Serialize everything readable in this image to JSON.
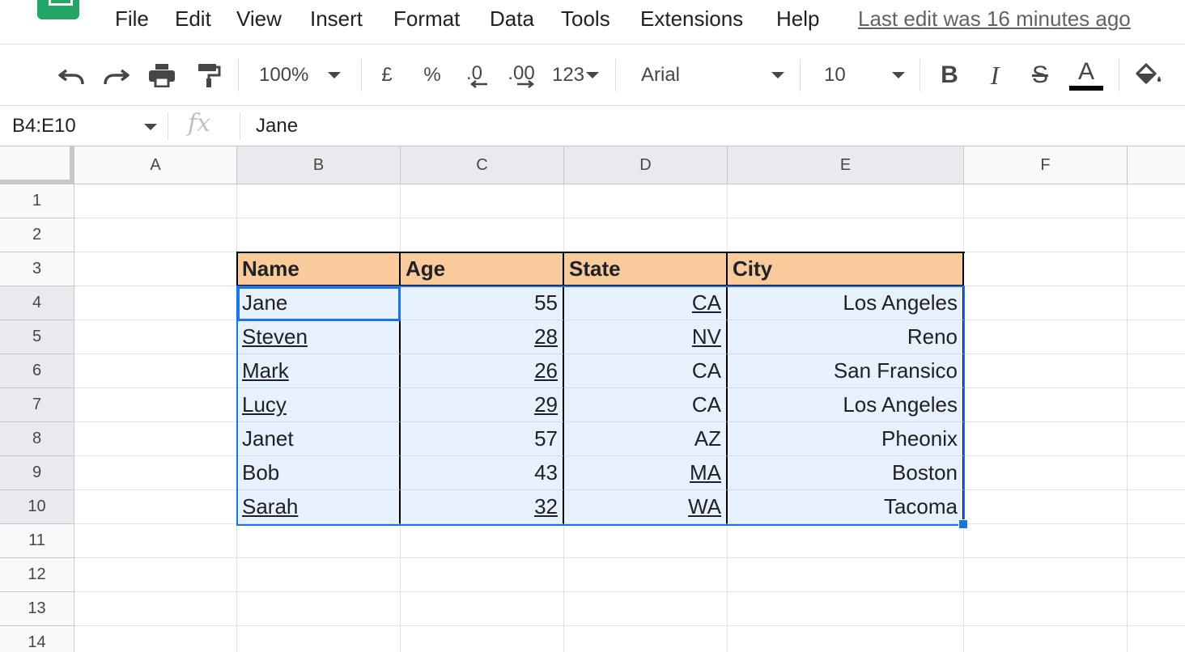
{
  "menu": {
    "items": [
      "File",
      "Edit",
      "View",
      "Insert",
      "Format",
      "Data",
      "Tools",
      "Extensions",
      "Help"
    ],
    "last_edit": "Last edit was 16 minutes ago"
  },
  "toolbar": {
    "zoom": "100%",
    "currency": "£",
    "percent": "%",
    "decrease_decimals": ".0",
    "increase_decimals": ".00",
    "more_formats": "123",
    "font": "Arial",
    "font_size": "10",
    "bold": "B",
    "italic": "I",
    "strikethrough": "S",
    "text_color_label": "A",
    "colors": {
      "text_color": "#000000"
    },
    "icons": [
      "undo-icon",
      "redo-icon",
      "print-icon",
      "paint-format-icon",
      "fill-color-icon"
    ]
  },
  "formula_bar": {
    "name_box": "B4:E10",
    "fx": "fx",
    "value": "Jane"
  },
  "grid": {
    "columns": [
      "A",
      "B",
      "C",
      "D",
      "E",
      "F"
    ],
    "rows": [
      "1",
      "2",
      "3",
      "4",
      "5",
      "6",
      "7",
      "8",
      "9",
      "10",
      "11",
      "12",
      "13",
      "14"
    ],
    "table": {
      "headers": [
        "Name",
        "Age",
        "State",
        "City"
      ],
      "rows": [
        [
          "Jane",
          "55",
          "CA",
          "Los Angeles"
        ],
        [
          "Steven",
          "28",
          "NV",
          "Reno"
        ],
        [
          "Mark",
          "26",
          "CA",
          "San Fransico"
        ],
        [
          "Lucy",
          "29",
          "CA",
          "Los Angeles"
        ],
        [
          "Janet",
          "57",
          "AZ",
          "Pheonix"
        ],
        [
          "Bob",
          "43",
          "MA",
          "Boston"
        ],
        [
          "Sarah",
          "32",
          "WA",
          "Tacoma"
        ]
      ],
      "underlined": [
        [
          false,
          false,
          true,
          false
        ],
        [
          true,
          true,
          true,
          false
        ],
        [
          true,
          true,
          false,
          false
        ],
        [
          true,
          true,
          false,
          false
        ],
        [
          false,
          false,
          false,
          false
        ],
        [
          false,
          false,
          true,
          false
        ],
        [
          true,
          true,
          true,
          false
        ]
      ],
      "colors": {
        "header_fill": "#f9cb9c",
        "selection_fill": "#e7f0fd",
        "selection_border": "#1a73e8"
      }
    }
  }
}
